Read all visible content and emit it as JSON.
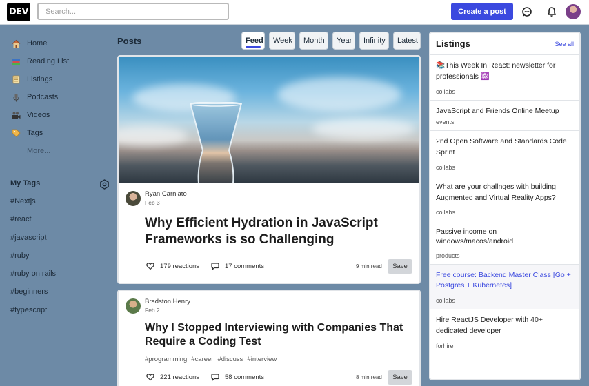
{
  "header": {
    "logo": "DEV",
    "search_placeholder": "Search...",
    "create_post": "Create a post"
  },
  "sidebar": {
    "nav": [
      {
        "label": "Home",
        "icon": "house-icon"
      },
      {
        "label": "Reading List",
        "icon": "books-icon"
      },
      {
        "label": "Listings",
        "icon": "scroll-icon"
      },
      {
        "label": "Podcasts",
        "icon": "microphone-icon"
      },
      {
        "label": "Videos",
        "icon": "film-camera-icon"
      },
      {
        "label": "Tags",
        "icon": "tag-icon"
      }
    ],
    "more": "More...",
    "my_tags_title": "My Tags",
    "tags": [
      "#Nextjs",
      "#react",
      "#javascript",
      "#ruby",
      "#ruby on rails",
      "#beginners",
      "#typescript"
    ]
  },
  "feed": {
    "title": "Posts",
    "tabs": [
      "Feed",
      "Week",
      "Month",
      "Year",
      "Infinity",
      "Latest"
    ],
    "active_tab": "Feed",
    "posts": [
      {
        "author": "Ryan Carniato",
        "date": "Feb 3",
        "title": "Why Efficient Hydration in JavaScript Frameworks is so Challenging",
        "reactions": "179 reactions",
        "comments": "17 comments",
        "read_time": "9 min read",
        "save": "Save"
      },
      {
        "author": "Bradston Henry",
        "date": "Feb 2",
        "title": "Why I Stopped Interviewing with Companies That Require a Coding Test",
        "tags": [
          "#programming",
          "#career",
          "#discuss",
          "#interview"
        ],
        "reactions": "221 reactions",
        "comments": "58 comments",
        "read_time": "8 min read",
        "save": "Save"
      }
    ]
  },
  "listings": {
    "title": "Listings",
    "see_all": "See all",
    "items": [
      {
        "text": "📚This Week In React: newsletter for professionals ⚛️",
        "category": "collabs"
      },
      {
        "text": "JavaScript and Friends Online Meetup",
        "category": "events"
      },
      {
        "text": "2nd Open Software and Standards Code Sprint",
        "category": "collabs"
      },
      {
        "text": "What are your challnges with building Augmented and Virtual Reality Apps?",
        "category": "collabs"
      },
      {
        "text": "Passive income on windows/macos/android",
        "category": "products"
      },
      {
        "text": "Free course: Backend Master Class [Go + Postgres + Kubernetes]",
        "category": "collabs"
      },
      {
        "text": "Hire ReactJS Developer with 40+ dedicated developer",
        "category": "forhire"
      }
    ]
  },
  "colors": {
    "accent": "#3b49df",
    "background": "#6d8aa6"
  }
}
